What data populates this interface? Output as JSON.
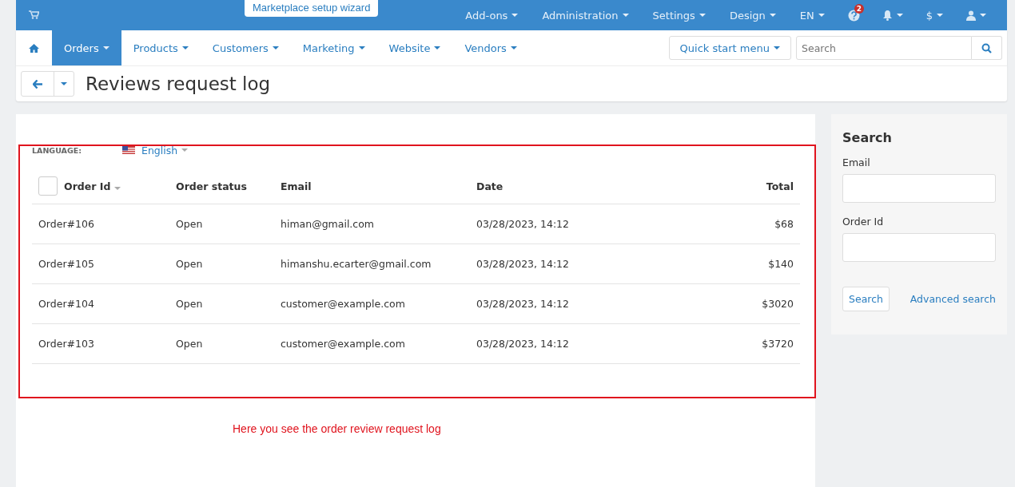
{
  "top_bar": {
    "wizard_tab": "Marketplace setup wizard",
    "menus": [
      {
        "kind": "text",
        "label": "Add-ons"
      },
      {
        "kind": "text",
        "label": "Administration"
      },
      {
        "kind": "text",
        "label": "Settings"
      },
      {
        "kind": "text",
        "label": "Design"
      },
      {
        "kind": "text",
        "label": "EN"
      },
      {
        "kind": "help",
        "badge": "2"
      },
      {
        "kind": "bell"
      },
      {
        "kind": "text",
        "label": "$"
      },
      {
        "kind": "user"
      }
    ]
  },
  "nav": {
    "items": [
      {
        "label": "Orders",
        "selected": true
      },
      {
        "label": "Products",
        "selected": false
      },
      {
        "label": "Customers",
        "selected": false
      },
      {
        "label": "Marketing",
        "selected": false
      },
      {
        "label": "Website",
        "selected": false
      },
      {
        "label": "Vendors",
        "selected": false
      }
    ],
    "quick_start": "Quick start menu",
    "search": {
      "placeholder": "Search"
    }
  },
  "page_title": "Reviews request log",
  "language": {
    "label": "LANGUAGE:",
    "value": "English"
  },
  "table": {
    "select_all": {
      "checked": false
    },
    "columns": [
      "Order Id",
      "Order status",
      "Email",
      "Date",
      "Total"
    ],
    "rows": [
      {
        "order_id": "Order#106",
        "status": "Open",
        "email": "himan@gmail.com",
        "date": "03/28/2023, 14:12",
        "total": "$68"
      },
      {
        "order_id": "Order#105",
        "status": "Open",
        "email": "himanshu.ecarter@gmail.com",
        "date": "03/28/2023, 14:12",
        "total": "$140"
      },
      {
        "order_id": "Order#104",
        "status": "Open",
        "email": "customer@example.com",
        "date": "03/28/2023, 14:12",
        "total": "$3020"
      },
      {
        "order_id": "Order#103",
        "status": "Open",
        "email": "customer@example.com",
        "date": "03/28/2023, 14:12",
        "total": "$3720"
      }
    ]
  },
  "annotation": "Here you see the order review request log",
  "sidebar": {
    "title": "Search",
    "fields": [
      {
        "label": "Email"
      },
      {
        "label": "Order Id"
      }
    ],
    "search_button": "Search",
    "advanced_link": "Advanced search"
  }
}
